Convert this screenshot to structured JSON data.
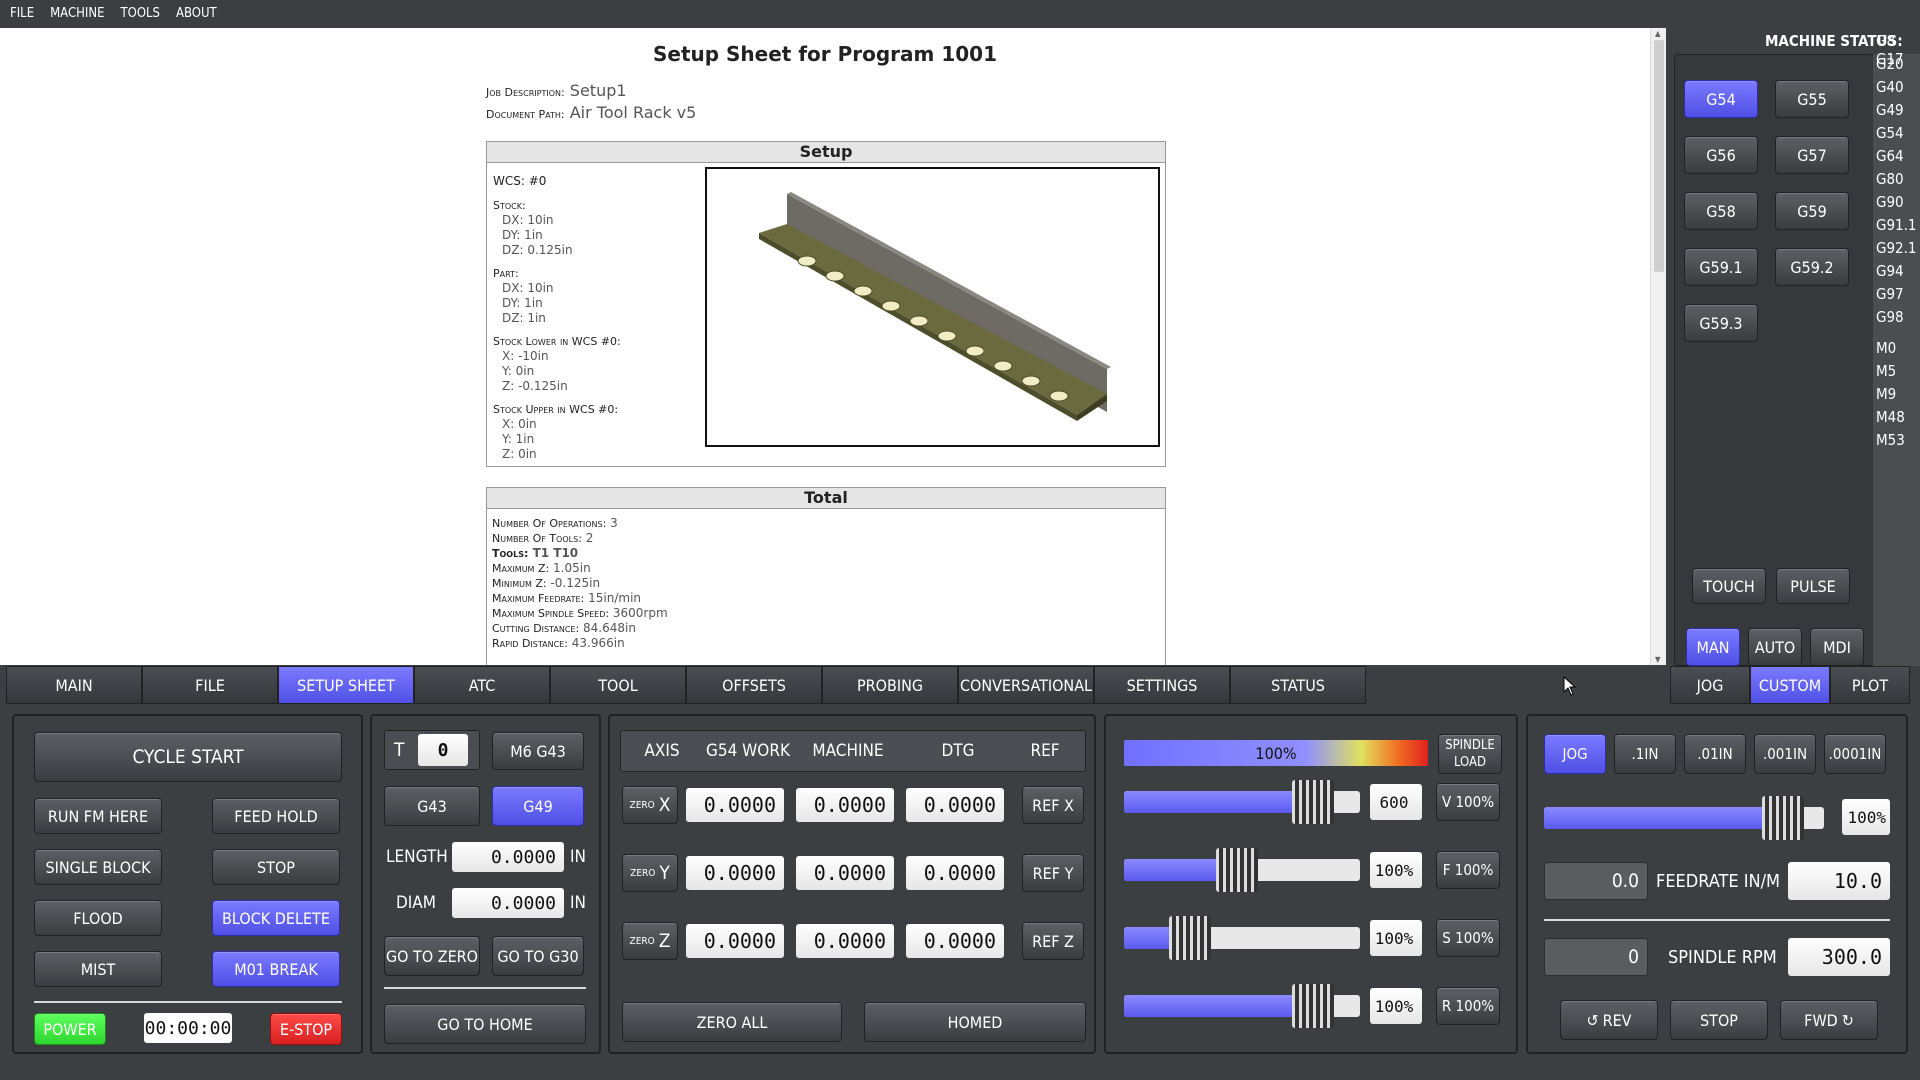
{
  "menu": [
    "FILE",
    "MACHINE",
    "TOOLS",
    "ABOUT"
  ],
  "doc": {
    "title": "Setup Sheet for Program 1001",
    "job_desc_label": "Job Description:",
    "job_desc": "Setup1",
    "doc_path_label": "Document Path:",
    "doc_path": "Air Tool Rack v5",
    "setup_header": "Setup",
    "wcs": "WCS: #0",
    "stock_label": "Stock:",
    "stock": [
      "DX: 10in",
      "DY: 1in",
      "DZ: 0.125in"
    ],
    "part_label": "Part:",
    "part": [
      "DX: 10in",
      "DY: 1in",
      "DZ: 1in"
    ],
    "stock_lower_label": "Stock Lower in WCS #0:",
    "stock_lower": [
      "X: -10in",
      "Y: 0in",
      "Z: -0.125in"
    ],
    "stock_upper_label": "Stock Upper in WCS #0:",
    "stock_upper": [
      "X: 0in",
      "Y: 1in",
      "Z: 0in"
    ],
    "total_header": "Total",
    "totals": [
      {
        "k": "Number Of Operations:",
        "v": "3"
      },
      {
        "k": "Number Of Tools:",
        "v": "2"
      },
      {
        "k": "Tools:",
        "v": "T1 T10"
      },
      {
        "k": "Maximum Z:",
        "v": "1.05in"
      },
      {
        "k": "Minimum Z:",
        "v": "-0.125in"
      },
      {
        "k": "Maximum Feedrate:",
        "v": "15in/min"
      },
      {
        "k": "Maximum Spindle Speed:",
        "v": "3600rpm"
      },
      {
        "k": "Cutting Distance:",
        "v": "84.648in"
      },
      {
        "k": "Rapid Distance:",
        "v": "43.966in"
      }
    ]
  },
  "status": {
    "label": "MACHINE STATUS:",
    "codes": [
      "G8 G17",
      "G20",
      "G40",
      "G49",
      "G54",
      "G64",
      "G80",
      "G90",
      "G91.1",
      "G92.1",
      "G94",
      "G97",
      "G98",
      "M0",
      "M5",
      "M9",
      "M48",
      "M53"
    ]
  },
  "wcs_buttons": [
    "G54",
    "G55",
    "G56",
    "G57",
    "G58",
    "G59",
    "G59.1",
    "G59.2",
    "G59.3"
  ],
  "touch": "TOUCH",
  "pulse": "PULSE",
  "modes": [
    "MAN",
    "AUTO",
    "MDI"
  ],
  "tabs": [
    "MAIN",
    "FILE",
    "SETUP SHEET",
    "ATC",
    "TOOL",
    "OFFSETS",
    "PROBING",
    "CONVERSATIONAL",
    "SETTINGS",
    "STATUS"
  ],
  "right_tabs": [
    "JOG",
    "CUSTOM",
    "PLOT"
  ],
  "controls": {
    "cycle_start": "CYCLE START",
    "run_from_here": "RUN FM HERE",
    "feed_hold": "FEED HOLD",
    "single_block": "SINGLE BLOCK",
    "stop": "STOP",
    "flood": "FLOOD",
    "block_delete": "BLOCK DELETE",
    "mist": "MIST",
    "m01_break": "M01 BREAK",
    "power": "POWER",
    "timer": "00:00:00",
    "estop": "E-STOP"
  },
  "tool": {
    "t_label": "T",
    "t_value": "0",
    "m6g43": "M6 G43",
    "g43": "G43",
    "g49": "G49",
    "length_label": "LENGTH",
    "length": "0.0000",
    "diam_label": "DIAM",
    "diam": "0.0000",
    "unit": "IN",
    "go_zero": "GO TO ZERO",
    "go_g30": "GO TO G30",
    "go_home": "GO TO HOME"
  },
  "dro": {
    "headers": [
      "AXIS",
      "G54 WORK",
      "MACHINE",
      "DTG",
      "REF"
    ],
    "rows": [
      {
        "zero": "ZERO",
        "axis": "X",
        "work": "0.0000",
        "mach": "0.0000",
        "dtg": "0.0000",
        "ref": "REF X"
      },
      {
        "zero": "ZERO",
        "axis": "Y",
        "work": "0.0000",
        "mach": "0.0000",
        "dtg": "0.0000",
        "ref": "REF Y"
      },
      {
        "zero": "ZERO",
        "axis": "Z",
        "work": "0.0000",
        "mach": "0.0000",
        "dtg": "0.0000",
        "ref": "REF Z"
      }
    ],
    "zero_all": "ZERO ALL",
    "homed": "HOMED"
  },
  "overrides": {
    "spindle_load_pct": "100%",
    "spindle_load_label": [
      "SPINDLE",
      "LOAD"
    ],
    "rows": [
      {
        "value": "600",
        "btn": "V 100%",
        "level": 0.72
      },
      {
        "value": "100%",
        "btn": "F 100%",
        "level": 0.4
      },
      {
        "value": "100%",
        "btn": "S 100%",
        "level": 0.2
      },
      {
        "value": "100%",
        "btn": "R 100%",
        "level": 0.72
      }
    ]
  },
  "jog": {
    "increments": [
      "JOG",
      ".1IN",
      ".01IN",
      ".001IN",
      ".0001IN"
    ],
    "jog_pct": "100%",
    "jog_level": 0.93,
    "feed_actual": "0.0",
    "feed_label": "FEEDRATE IN/M",
    "feed_set": "10.0",
    "spindle_actual": "0",
    "spindle_label": "SPINDLE RPM",
    "spindle_set": "300.0",
    "rev": "REV",
    "stop": "STOP",
    "fwd": "FWD"
  },
  "colors": {
    "accent": "#5a5af0",
    "bg": "#3b3f42",
    "power": "#39e039",
    "estop": "#e02a2a"
  }
}
